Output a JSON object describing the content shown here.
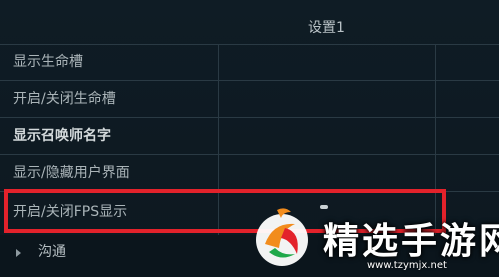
{
  "settings_table": {
    "column_header": "设置1",
    "rows": [
      {
        "label": "显示生命槽"
      },
      {
        "label": "开启/关闭生命槽"
      },
      {
        "label": "显示召唤师名字"
      },
      {
        "label": "显示/隐藏用户界面"
      },
      {
        "label": "开启/关闭FPS显示"
      }
    ],
    "highlighted_row": "开启/关闭FPS显示",
    "highlight_color": "#e3222b"
  },
  "section": {
    "label": "沟通"
  },
  "watermark": {
    "title": "精选手游网",
    "url": "www.tzymjx.net"
  }
}
